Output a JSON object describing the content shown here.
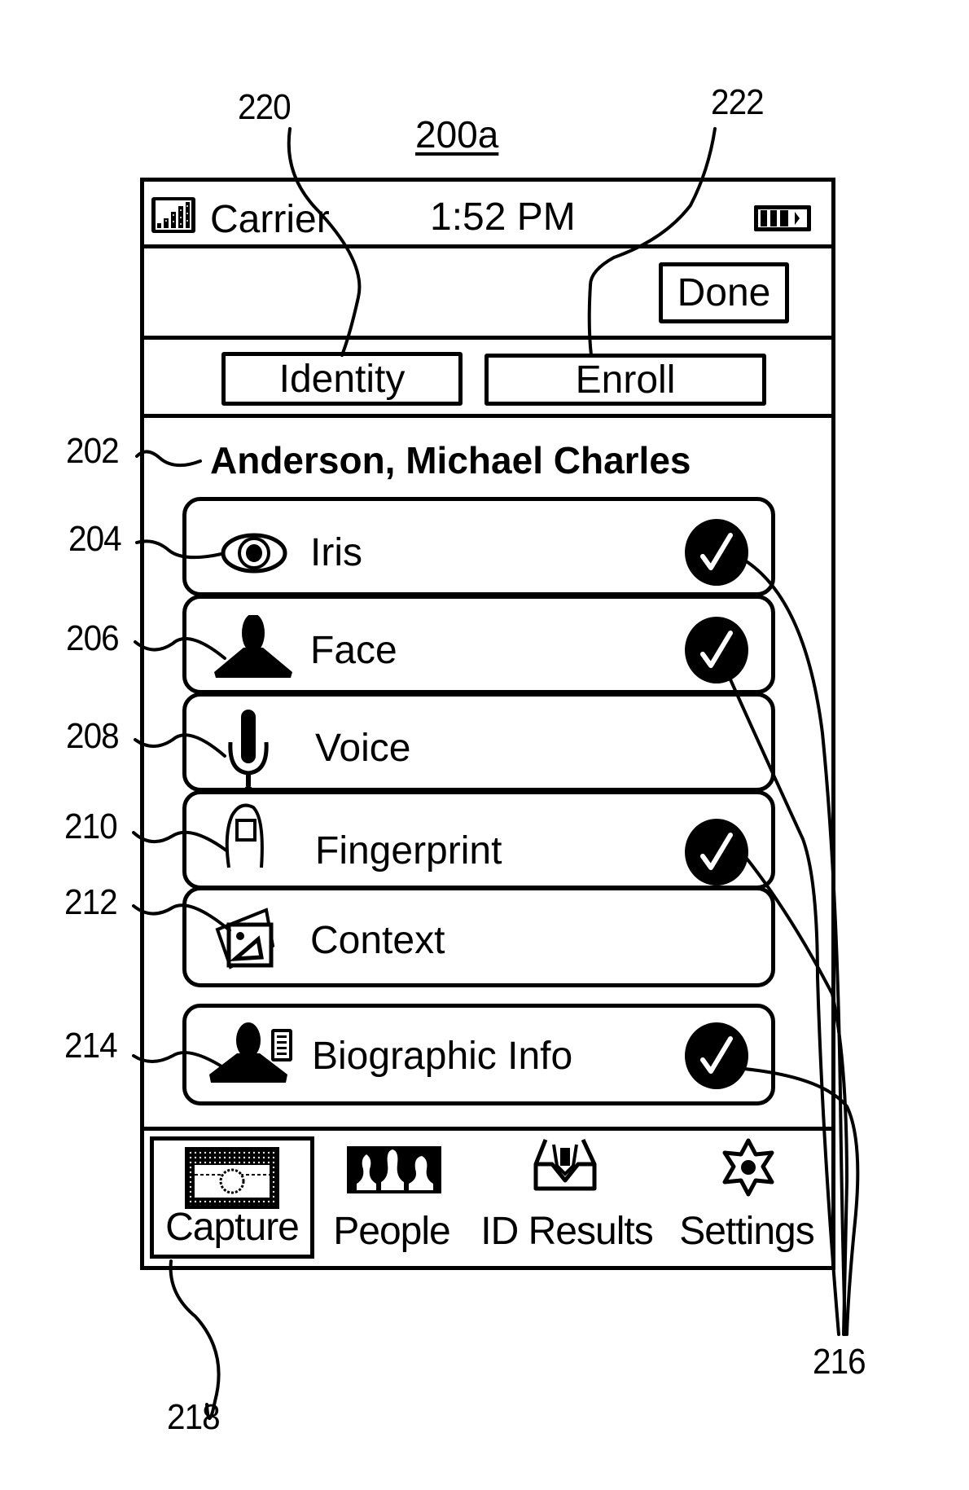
{
  "figure": {
    "title": "200a",
    "reference_numerals": {
      "identity_tab": "220",
      "enroll_tab": "222",
      "subject_name": "202",
      "iris_row": "204",
      "face_row": "206",
      "voice_row": "208",
      "fingerprint_row": "210",
      "context_row": "212",
      "biographic_row": "214",
      "check_marks": "216",
      "capture_tab": "218"
    }
  },
  "status_bar": {
    "signal_icon": "signal-bars-icon",
    "carrier": "Carrier",
    "time": "1:52 PM",
    "battery_icon": "battery-icon"
  },
  "toolbar": {
    "done_label": "Done"
  },
  "segments": [
    {
      "label": "Identity"
    },
    {
      "label": "Enroll"
    }
  ],
  "subject": {
    "name": "Anderson, Michael Charles"
  },
  "modalities": [
    {
      "label": "Iris",
      "icon": "eye-icon",
      "captured": true
    },
    {
      "label": "Face",
      "icon": "person-silhouette-icon",
      "captured": true
    },
    {
      "label": "Voice",
      "icon": "microphone-icon",
      "captured": false
    },
    {
      "label": "Fingerprint",
      "icon": "fingerprint-icon",
      "captured": true
    },
    {
      "label": "Context",
      "icon": "photos-icon",
      "captured": false
    },
    {
      "label": "Biographic Info",
      "icon": "person-id-card-icon",
      "captured": true
    }
  ],
  "tab_bar": {
    "items": [
      {
        "label": "Capture",
        "icon": "camera-icon",
        "selected": true
      },
      {
        "label": "People",
        "icon": "people-group-icon",
        "selected": false
      },
      {
        "label": "ID Results",
        "icon": "id-results-inbox-icon",
        "selected": false
      },
      {
        "label": "Settings",
        "icon": "gear-star-icon",
        "selected": false
      }
    ]
  }
}
